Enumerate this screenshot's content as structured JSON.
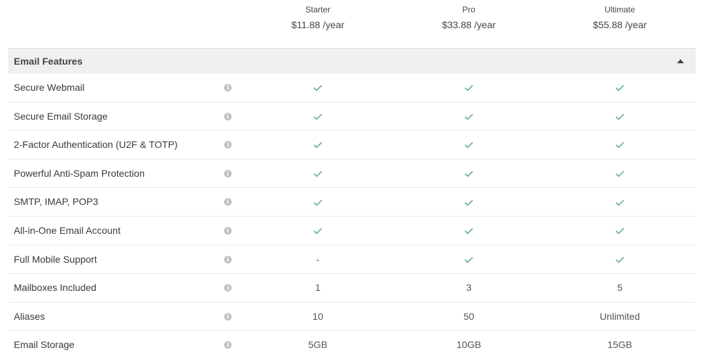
{
  "plans": [
    {
      "name": "Starter",
      "price": "$11.88 /year"
    },
    {
      "name": "Pro",
      "price": "$33.88 /year"
    },
    {
      "name": "Ultimate",
      "price": "$55.88 /year"
    }
  ],
  "section": {
    "title": "Email Features",
    "toggle_icon": "caret-up-icon"
  },
  "colors": {
    "check": "#6fb29a",
    "info_icon": "#c2c2c2",
    "header_bg": "#f0f0f0"
  },
  "features": [
    {
      "name": "Secure Webmail",
      "values": [
        "check",
        "check",
        "check"
      ]
    },
    {
      "name": "Secure Email Storage",
      "values": [
        "check",
        "check",
        "check"
      ]
    },
    {
      "name": "2-Factor Authentication (U2F & TOTP)",
      "values": [
        "check",
        "check",
        "check"
      ]
    },
    {
      "name": "Powerful Anti-Spam Protection",
      "values": [
        "check",
        "check",
        "check"
      ]
    },
    {
      "name": "SMTP, IMAP, POP3",
      "values": [
        "check",
        "check",
        "check"
      ]
    },
    {
      "name": "All-in-One Email Account",
      "values": [
        "check",
        "check",
        "check"
      ]
    },
    {
      "name": "Full Mobile Support",
      "values": [
        "-",
        "check",
        "check"
      ]
    },
    {
      "name": "Mailboxes Included",
      "values": [
        "1",
        "3",
        "5"
      ]
    },
    {
      "name": "Aliases",
      "values": [
        "10",
        "50",
        "Unlimited"
      ]
    },
    {
      "name": "Email Storage",
      "values": [
        "5GB",
        "10GB",
        "15GB"
      ]
    }
  ]
}
